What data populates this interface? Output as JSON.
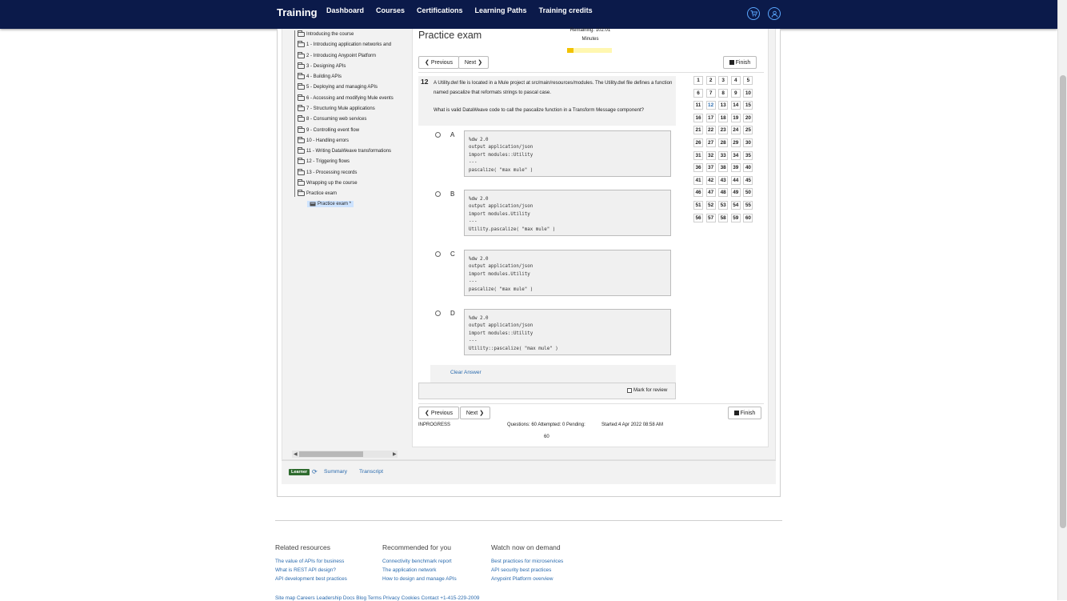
{
  "nav": {
    "brand": "Training",
    "links": [
      "Dashboard",
      "Courses",
      "Certifications",
      "Learning Paths",
      "Training credits"
    ],
    "icons": [
      "cart-icon",
      "user-icon"
    ]
  },
  "tree": {
    "items": [
      "Introducing the course",
      "1 - Introducing application networks and",
      "2 - Introducing Anypoint Platform",
      "3 - Designing APIs",
      "4 - Building APIs",
      "5 - Deploying and managing APIs",
      "6 - Accessing and modifying Mule events",
      "7 - Structuring Mule applications",
      "8 - Consuming web services",
      "9 - Controlling event flow",
      "10 - Handling errors",
      "11 - Writing DataWeave transformations",
      "12 - Triggering flows",
      "13 - Processing records",
      "Wrapping up the course",
      "Practice exam"
    ],
    "active": "Practice exam *"
  },
  "exam": {
    "title": "Practice exam",
    "remaining_label": "Remaining: 102:01",
    "minutes_label": "Minutes",
    "time_progress": 0.15,
    "prev_label": "Previous",
    "next_label": "Next",
    "finish_label": "Finish",
    "question_number": "12",
    "question_line1": "A Utility.dwl file is located in a Mule project at src/main/resources/modules. The Utility.dwl file defines a function named pascalize that reformats strings to pascal case.",
    "question_line2": "What is valid DataWeave code to call the pascalize function in a Transform Message component?",
    "options": [
      {
        "letter": "A",
        "code": "%dw 2.0\noutput application/json\nimport modules::Utility\n---\npascalize( \"max mule\" )"
      },
      {
        "letter": "B",
        "code": "%dw 2.0\noutput application/json\nimport modules.Utility\n---\nUtility.pascalize( \"max mule\" )"
      },
      {
        "letter": "C",
        "code": "%dw 2.0\noutput application/json\nimport modules.Utility\n---\npascalize( \"max mule\" )"
      },
      {
        "letter": "D",
        "code": "%dw 2.0\noutput application/json\nimport modules::Utility\n---\nUtility::pascalize( \"max mule\" )"
      }
    ],
    "clear_answer": "Clear Answer",
    "mark_review": "Mark for review",
    "status": "INPROGRESS",
    "counts_line1": "Questions: 60 Attempted: 0 Pending:",
    "counts_line2": "60",
    "started": "Started:4 Apr 2022 08:58 AM",
    "current_question": 12,
    "total_questions": 60
  },
  "bottom": {
    "badge": "Learner",
    "summary": "Summary",
    "transcript": "Transcript"
  },
  "footer": {
    "columns": [
      {
        "title": "Related resources",
        "links": [
          "The value of APIs for business",
          "What is REST API design?",
          "API development best practices"
        ]
      },
      {
        "title": "Recommended for you",
        "links": [
          "Connectivity benchmark report",
          "The application network",
          "How to design and manage APIs"
        ]
      },
      {
        "title": "Watch now on demand",
        "links": [
          "Best practices for microservices",
          "API security best practices",
          "Anypoint Platform overview"
        ]
      }
    ],
    "bottom_line": "Site map    Careers    Leadership    Docs    Blog    Terms    Privacy    Cookies    Contact    +1-415-229-2009"
  }
}
